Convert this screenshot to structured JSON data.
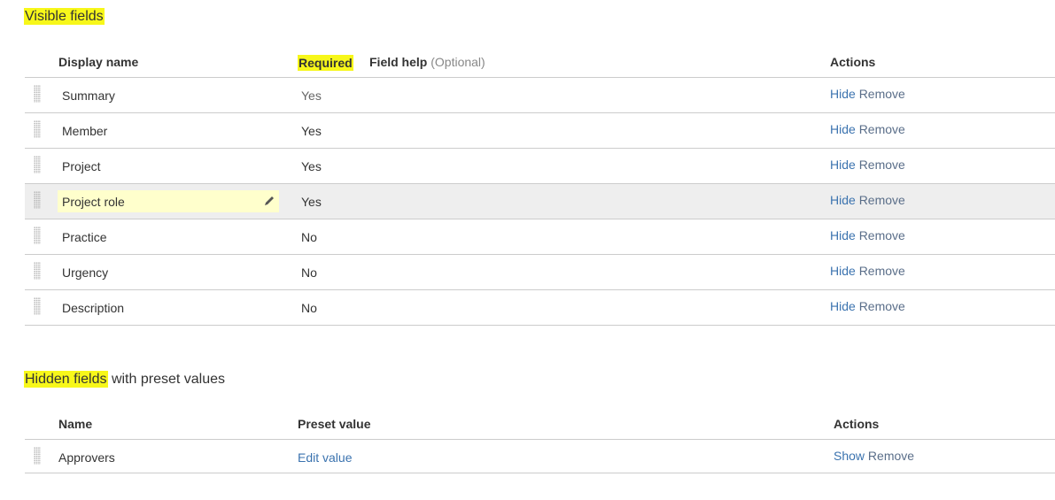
{
  "visible_section": {
    "title_highlighted": "Visible fields",
    "title_rest": "",
    "headers": {
      "display_name": "Display name",
      "required": "Required",
      "field_help": "Field help",
      "field_help_optional": "(Optional)",
      "actions": "Actions"
    },
    "rows": [
      {
        "name": "Summary",
        "required": "Yes",
        "action1": "Hide",
        "action2": "Remove"
      },
      {
        "name": "Member",
        "required": "Yes",
        "action1": "Hide",
        "action2": "Remove"
      },
      {
        "name": "Project",
        "required": "Yes",
        "action1": "Hide",
        "action2": "Remove"
      },
      {
        "name": "Project role",
        "required": "Yes",
        "action1": "Hide",
        "action2": "Remove"
      },
      {
        "name": "Practice",
        "required": "No",
        "action1": "Hide",
        "action2": "Remove"
      },
      {
        "name": "Urgency",
        "required": "No",
        "action1": "Hide",
        "action2": "Remove"
      },
      {
        "name": "Description",
        "required": "No",
        "action1": "Hide",
        "action2": "Remove"
      }
    ]
  },
  "hidden_section": {
    "title_highlighted": "Hidden fields",
    "title_rest": " with preset values",
    "headers": {
      "name": "Name",
      "preset_value": "Preset value",
      "actions": "Actions"
    },
    "rows": [
      {
        "name": "Approvers",
        "preset": "Edit value",
        "action1": "Show",
        "action2": "Remove"
      }
    ]
  },
  "colors": {
    "highlight": "#f7f71a",
    "link": "#3b73af",
    "active_row": "#eeeeee",
    "edit_box": "#ffffcc"
  }
}
